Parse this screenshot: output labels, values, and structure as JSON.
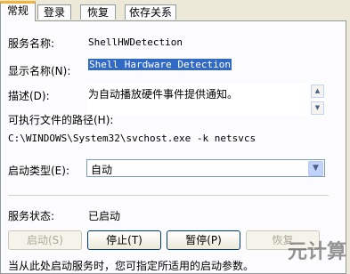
{
  "tabs": [
    {
      "label": "常规"
    },
    {
      "label": "登录"
    },
    {
      "label": "恢复"
    },
    {
      "label": "依存关系"
    }
  ],
  "fields": {
    "service_name_label": "服务名称:",
    "service_name_value": "ShellHWDetection",
    "display_name_label": "显示名称(N):",
    "display_name_value": "Shell Hardware Detection",
    "description_label": "描述(D):",
    "description_value": "为自动播放硬件事件提供通知。",
    "exe_path_label": "可执行文件的路径(H):",
    "exe_path_value": "C:\\WINDOWS\\System32\\svchost.exe -k netsvcs",
    "startup_type_label": "启动类型(E):",
    "startup_type_value": "自动",
    "service_status_label": "服务状态:",
    "service_status_value": "已启动"
  },
  "buttons": {
    "start": "启动(S)",
    "stop": "停止(T)",
    "pause": "暂停(P)",
    "resume": "恢复"
  },
  "footer_text": "当从此处启动服务时，您可指定所适用的启动参数。",
  "watermark": "元计算",
  "icons": {
    "scroll_up": "triangle-up",
    "scroll_down": "triangle-down",
    "dropdown": "chevron-down"
  }
}
